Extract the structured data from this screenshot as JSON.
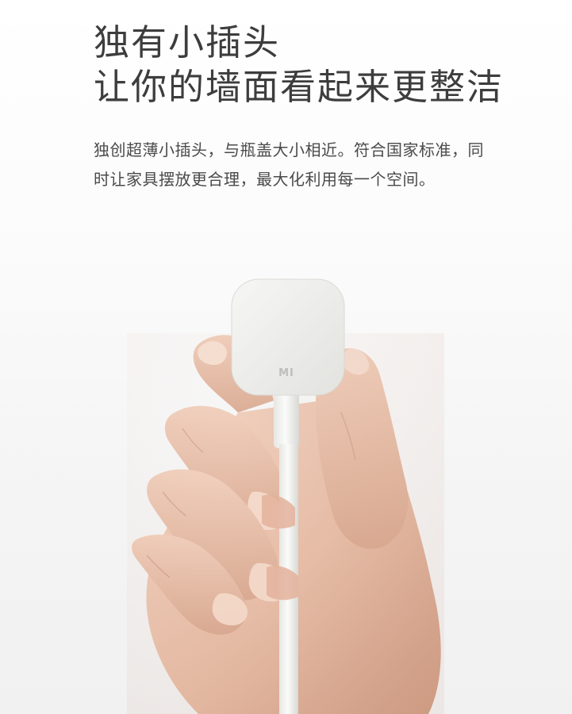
{
  "headline": {
    "line1": "独有小插头",
    "line2": "让你的墙面看起来更整洁"
  },
  "description": "独创超薄小插头，与瓶盖大小相近。符合国家标准，同时让家具摆放更合理，最大化利用每一个空间。",
  "photo": {
    "logo": "MI"
  },
  "colors": {
    "text": "#3d3d3d",
    "background": "#ffffff",
    "plug": "#eeeeec",
    "skin": "#e9c2ac"
  }
}
